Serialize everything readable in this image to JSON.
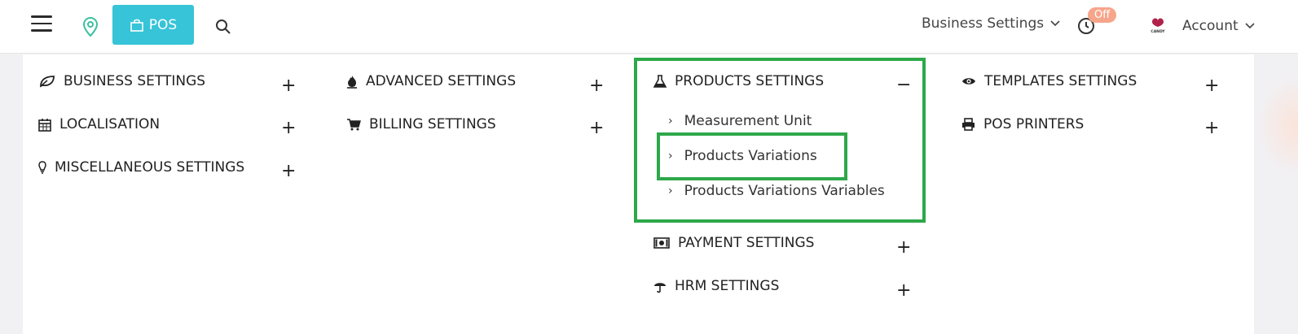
{
  "header": {
    "pos_label": "POS",
    "business_settings_label": "Business Settings",
    "off_badge": "Off",
    "account_label": "Account",
    "avatar_text": "CANDY"
  },
  "menu": {
    "business_settings": "BUSINESS SETTINGS",
    "localisation": "LOCALISATION",
    "miscellaneous_settings": "MISCELLANEOUS SETTINGS",
    "advanced_settings": "ADVANCED SETTINGS",
    "billing_settings": "BILLING SETTINGS",
    "products_settings": "PRODUCTS SETTINGS",
    "products_sub": {
      "measurement_unit": "Measurement Unit",
      "products_variations": "Products Variations",
      "products_variations_variables": "Products Variations Variables"
    },
    "payment_settings": "PAYMENT SETTINGS",
    "hrm_settings": "HRM SETTINGS",
    "templates_settings": "TEMPLATES SETTINGS",
    "pos_printers": "POS PRINTERS",
    "expand_symbol": "+",
    "collapse_symbol": "−"
  },
  "colors": {
    "accent": "#37c4d8",
    "highlight": "#2ea84a",
    "badge": "#f6a58b"
  }
}
